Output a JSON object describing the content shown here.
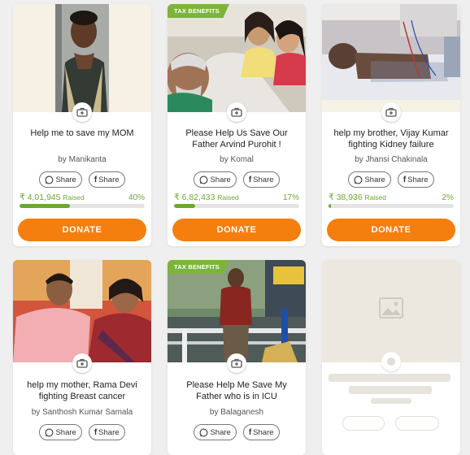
{
  "cards": [
    {
      "title": "Help me to save my MOM",
      "author": "by Manikanta",
      "raised": "₹ 4,01,945",
      "raised_label": "Raised",
      "percent": "40%",
      "progress": 0.4,
      "tax_benefits": false
    },
    {
      "title": "Please Help Us Save Our Father Arvind Purohit !",
      "author": "by Komal",
      "raised": "₹ 6,82,433",
      "raised_label": "Raised",
      "percent": "17%",
      "progress": 0.17,
      "tax_benefits": true,
      "badge": "TAX BENEFITS"
    },
    {
      "title": "help my brother, Vijay Kumar fighting Kidney failure",
      "author": "by Jhansi Chakinala",
      "raised": "₹ 38,936",
      "raised_label": "Raised",
      "percent": "2%",
      "progress": 0.02,
      "tax_benefits": false
    },
    {
      "title": "help my mother, Rama Devi fighting Breast cancer",
      "author": "by Santhosh Kumar Samala",
      "tax_benefits": false
    },
    {
      "title": "Please Help Me Save My Father who is in ICU",
      "author": "by Balaganesh",
      "tax_benefits": true,
      "badge": "TAX BENEFITS"
    }
  ],
  "share_whatsapp": "Share",
  "share_facebook": "Share",
  "donate_label": "DONATE",
  "colors": {
    "accent": "#f47f0f",
    "progress": "#6aa832",
    "tax_badge": "#7bb53b"
  }
}
